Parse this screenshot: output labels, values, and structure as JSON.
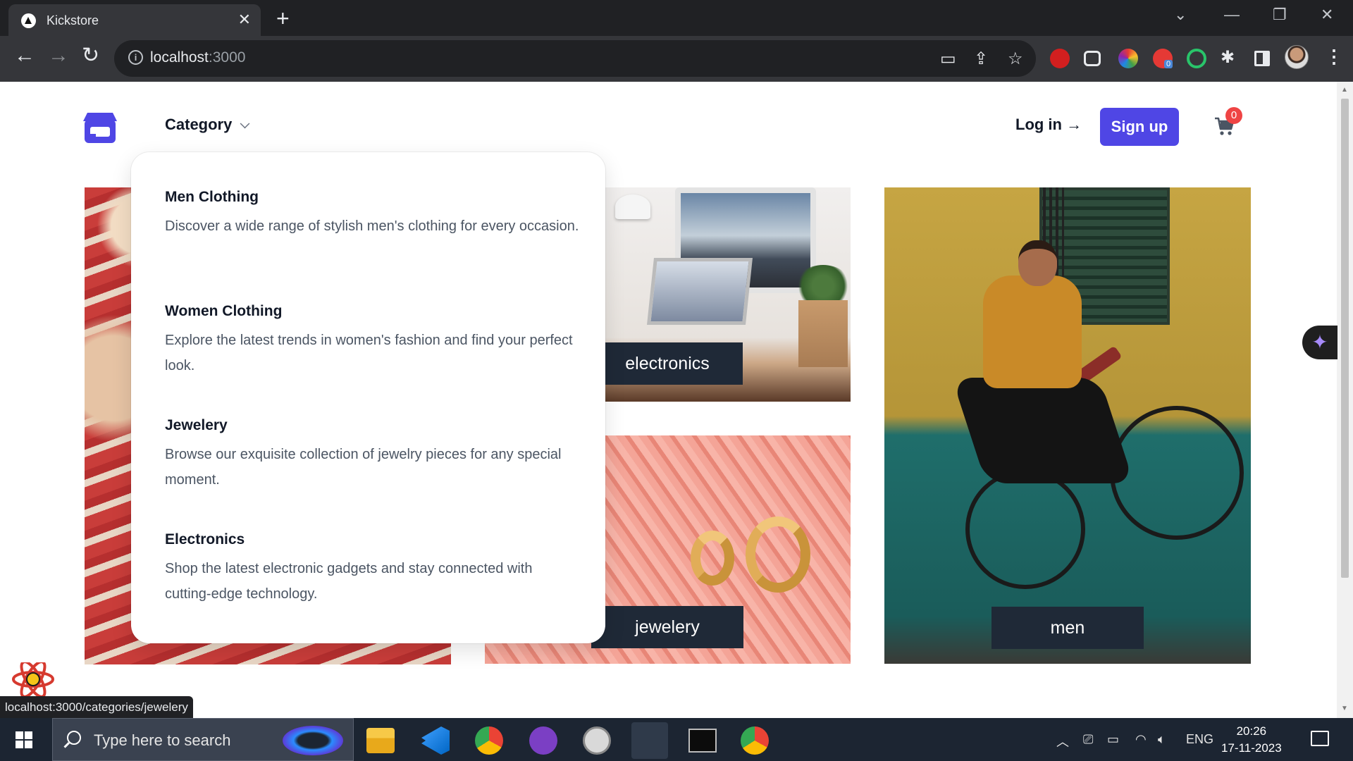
{
  "browser": {
    "tab_title": "Kickstore",
    "tab_close": "✕",
    "new_tab": "+",
    "url_host": "localhost",
    "url_port": ":3000",
    "window_minimize": "—",
    "window_restore": "❐",
    "window_close": "✕",
    "tab_search": "⌄"
  },
  "header": {
    "category_label": "Category",
    "login_label": "Log in →",
    "signup_label": "Sign up",
    "cart_count": "0"
  },
  "dropdown": {
    "items": [
      {
        "title": "Men Clothing",
        "description": "Discover a wide range of stylish men's clothing for every occasion."
      },
      {
        "title": "Women Clothing",
        "description": "Explore the latest trends in women's fashion and find your perfect look."
      },
      {
        "title": "Jewelery",
        "description": "Browse our exquisite collection of jewelry pieces for any special moment."
      },
      {
        "title": "Electronics",
        "description": "Shop the latest electronic gadgets and stay connected with cutting-edge technology."
      }
    ]
  },
  "cards": {
    "electronics_label": "electronics",
    "jewelery_label": "jewelery",
    "men_label": "men"
  },
  "status_bar_url": "localhost:3000/categories/jewelery",
  "taskbar": {
    "search_placeholder": "Type here to search",
    "language": "ENG",
    "time": "20:26",
    "date": "17-11-2023"
  },
  "colors": {
    "accent": "#4f46e5",
    "badge": "#ef4444",
    "card_label_bg": "#1f2937"
  }
}
